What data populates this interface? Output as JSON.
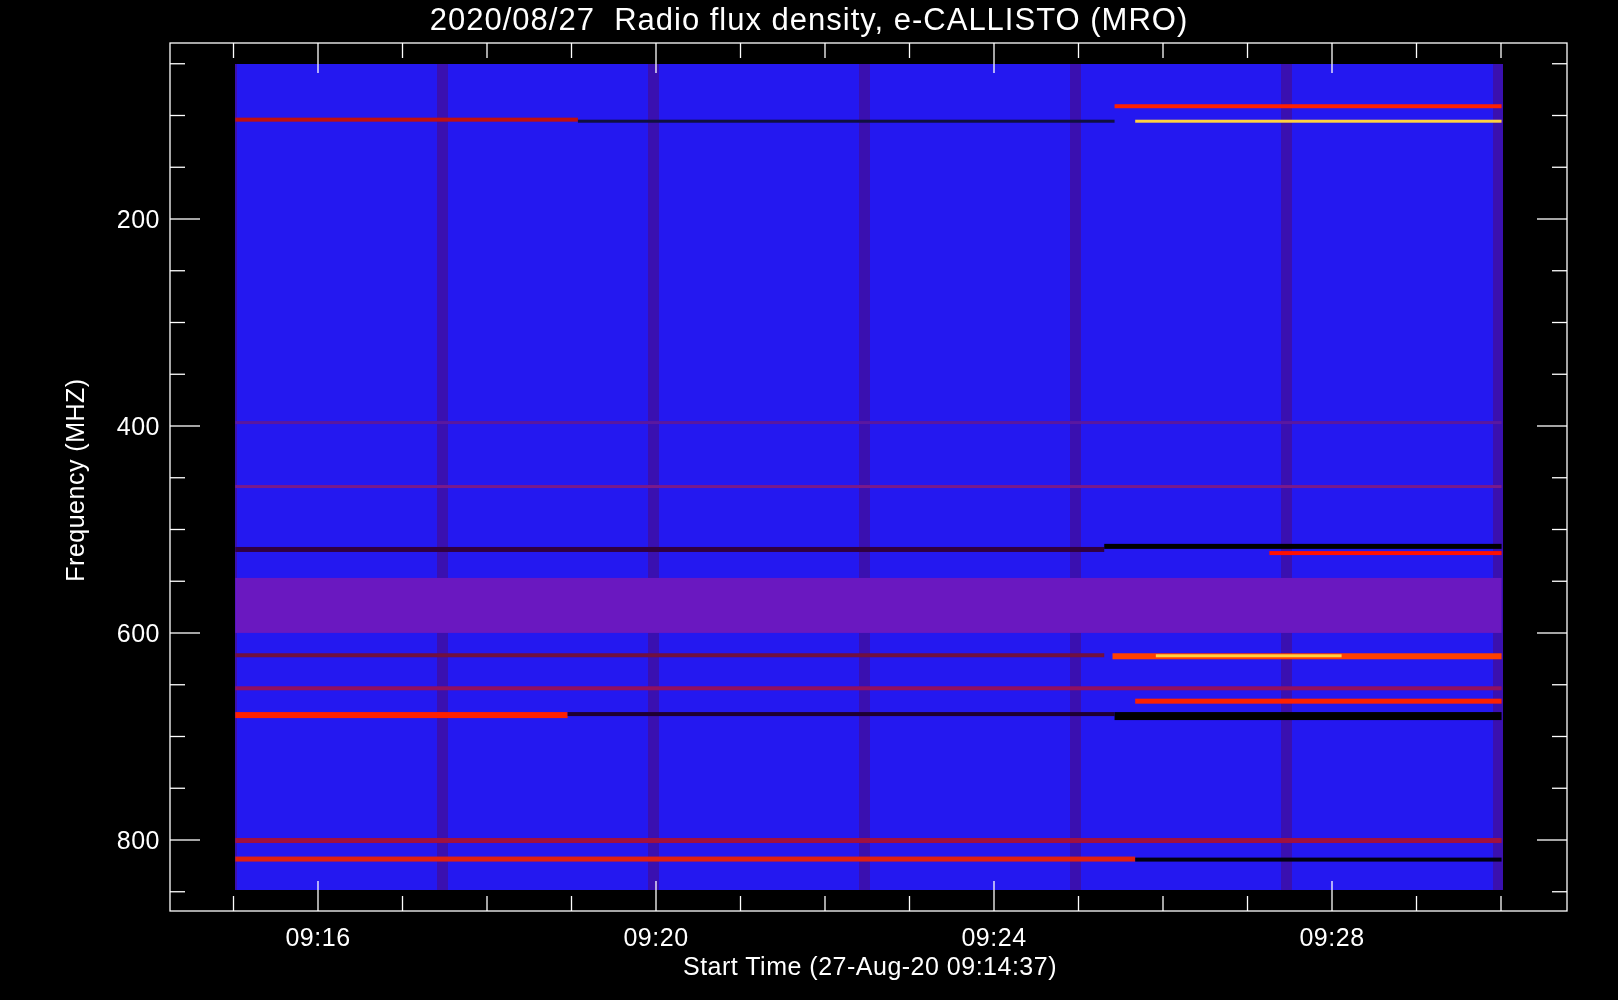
{
  "plot": {
    "title": "2020/08/27  Radio flux density, e-CALLISTO (MRO)",
    "ylabel": "Frequency (MHZ)",
    "xlabel": "Start Time (27-Aug-20 09:14:37)",
    "yticks": [
      "200",
      "400",
      "600",
      "800"
    ],
    "xticks": [
      "09:16",
      "09:20",
      "09:24",
      "09:28"
    ]
  }
}
